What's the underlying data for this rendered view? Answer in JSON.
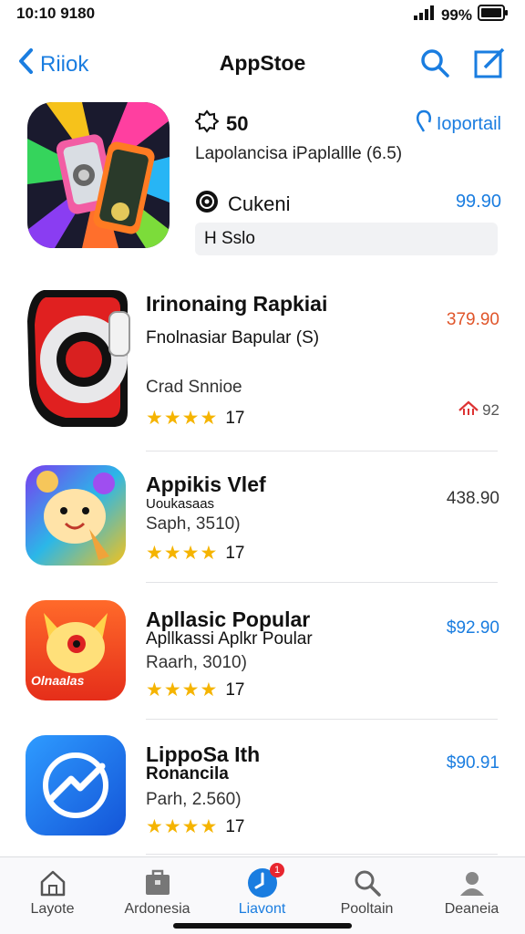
{
  "status": {
    "time": "10:10 9180",
    "battery": "99%"
  },
  "nav": {
    "back_label": "Riiok",
    "title": "AppStoe"
  },
  "featured": {
    "rating": "50",
    "link_label": "Ioportail",
    "subtitle": "Lapolancisa iPaplallle (6.5)",
    "owner": "Cukeni",
    "price": "99.90",
    "tag": "H Sslo"
  },
  "apps": [
    {
      "name": "Irinonaing Rapkiai",
      "line2": "Fnolnasiar Bapular (S)",
      "line3": "Crad Snnioe",
      "rating_count": "17",
      "price": "379.90",
      "price_color": "#e0552a",
      "extra": "92"
    },
    {
      "name": "Appikis Vlef",
      "line2": "Uoukasaas",
      "line3": "Saph, 3510)",
      "rating_count": "17",
      "price": "438.90",
      "price_color": "#333333"
    },
    {
      "name": "Apllasic Popular",
      "line2": "Apllkassi Aplkr Poular",
      "line3": "Raarh, 3010)",
      "rating_count": "17",
      "price": "$92.90",
      "price_color": "#1a7de0",
      "icon_text": "Olnaalas"
    },
    {
      "name": "LippoSa Ith",
      "line2": "Ronancila",
      "line3": "Parh, 2.560)",
      "rating_count": "17",
      "price": "$90.91",
      "price_color": "#1a7de0"
    }
  ],
  "tabs": [
    {
      "label": "Layote"
    },
    {
      "label": "Ardonesia"
    },
    {
      "label": "Liavont",
      "badge": "1"
    },
    {
      "label": "Pooltain"
    },
    {
      "label": "Deaneia"
    }
  ]
}
